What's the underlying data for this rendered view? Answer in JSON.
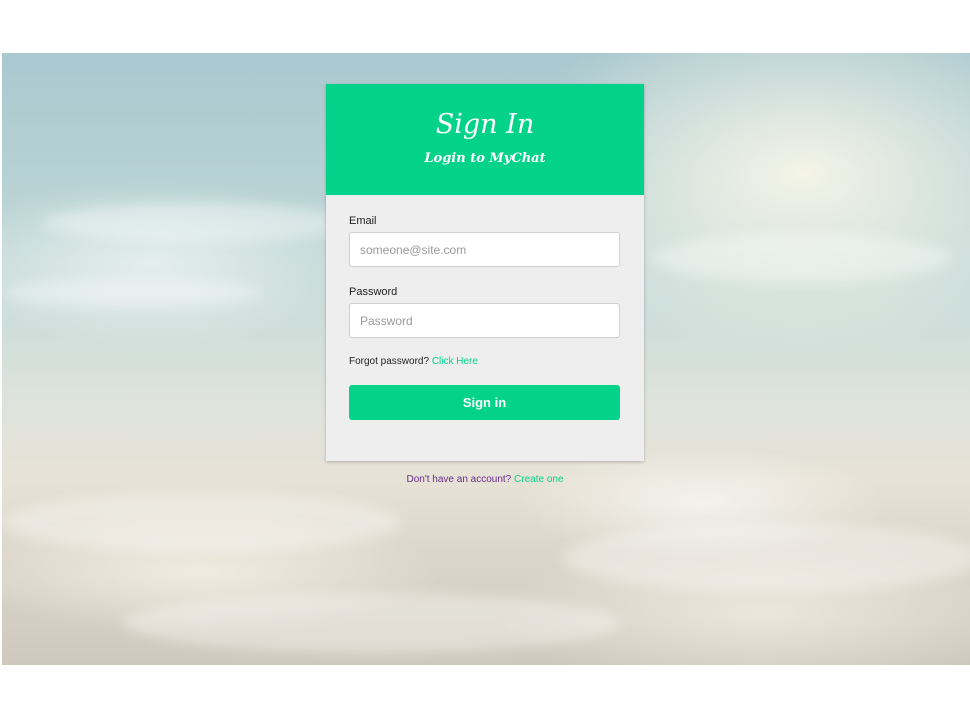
{
  "card": {
    "title": "Sign In",
    "subtitle": "Login to MyChat"
  },
  "form": {
    "email_label": "Email",
    "email_placeholder": "someone@site.com",
    "email_value": "",
    "password_label": "Password",
    "password_placeholder": "Password",
    "password_value": "",
    "forgot_text": "Forgot password?",
    "forgot_link": "Click Here",
    "submit_label": "Sign in"
  },
  "footer": {
    "no_account_text": "Don't have an account?",
    "create_link": "Create one"
  },
  "colors": {
    "accent": "#03d38a",
    "card_background": "#eeeeee",
    "footer_text": "#6a2d8a"
  }
}
